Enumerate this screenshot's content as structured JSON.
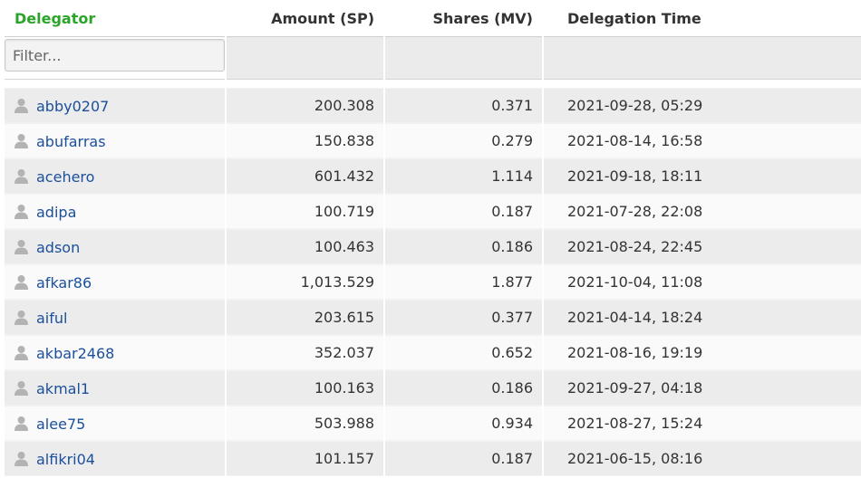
{
  "header": {
    "delegator": "Delegator",
    "amount": "Amount (SP)",
    "shares": "Shares (MV)",
    "time": "Delegation Time"
  },
  "filter": {
    "placeholder": "Filter..."
  },
  "rows": [
    {
      "user": "abby0207",
      "amount": "200.308",
      "shares": "0.371",
      "time": "2021-09-28, 05:29"
    },
    {
      "user": "abufarras",
      "amount": "150.838",
      "shares": "0.279",
      "time": "2021-08-14, 16:58"
    },
    {
      "user": "acehero",
      "amount": "601.432",
      "shares": "1.114",
      "time": "2021-09-18, 18:11"
    },
    {
      "user": "adipa",
      "amount": "100.719",
      "shares": "0.187",
      "time": "2021-07-28, 22:08"
    },
    {
      "user": "adson",
      "amount": "100.463",
      "shares": "0.186",
      "time": "2021-08-24, 22:45"
    },
    {
      "user": "afkar86",
      "amount": "1,013.529",
      "shares": "1.877",
      "time": "2021-10-04, 11:08"
    },
    {
      "user": "aiful",
      "amount": "203.615",
      "shares": "0.377",
      "time": "2021-04-14, 18:24"
    },
    {
      "user": "akbar2468",
      "amount": "352.037",
      "shares": "0.652",
      "time": "2021-08-16, 19:19"
    },
    {
      "user": "akmal1",
      "amount": "100.163",
      "shares": "0.186",
      "time": "2021-09-27, 04:18"
    },
    {
      "user": "alee75",
      "amount": "503.988",
      "shares": "0.934",
      "time": "2021-08-27, 15:24"
    },
    {
      "user": "alfikri04",
      "amount": "101.157",
      "shares": "0.187",
      "time": "2021-06-15, 08:16"
    }
  ]
}
